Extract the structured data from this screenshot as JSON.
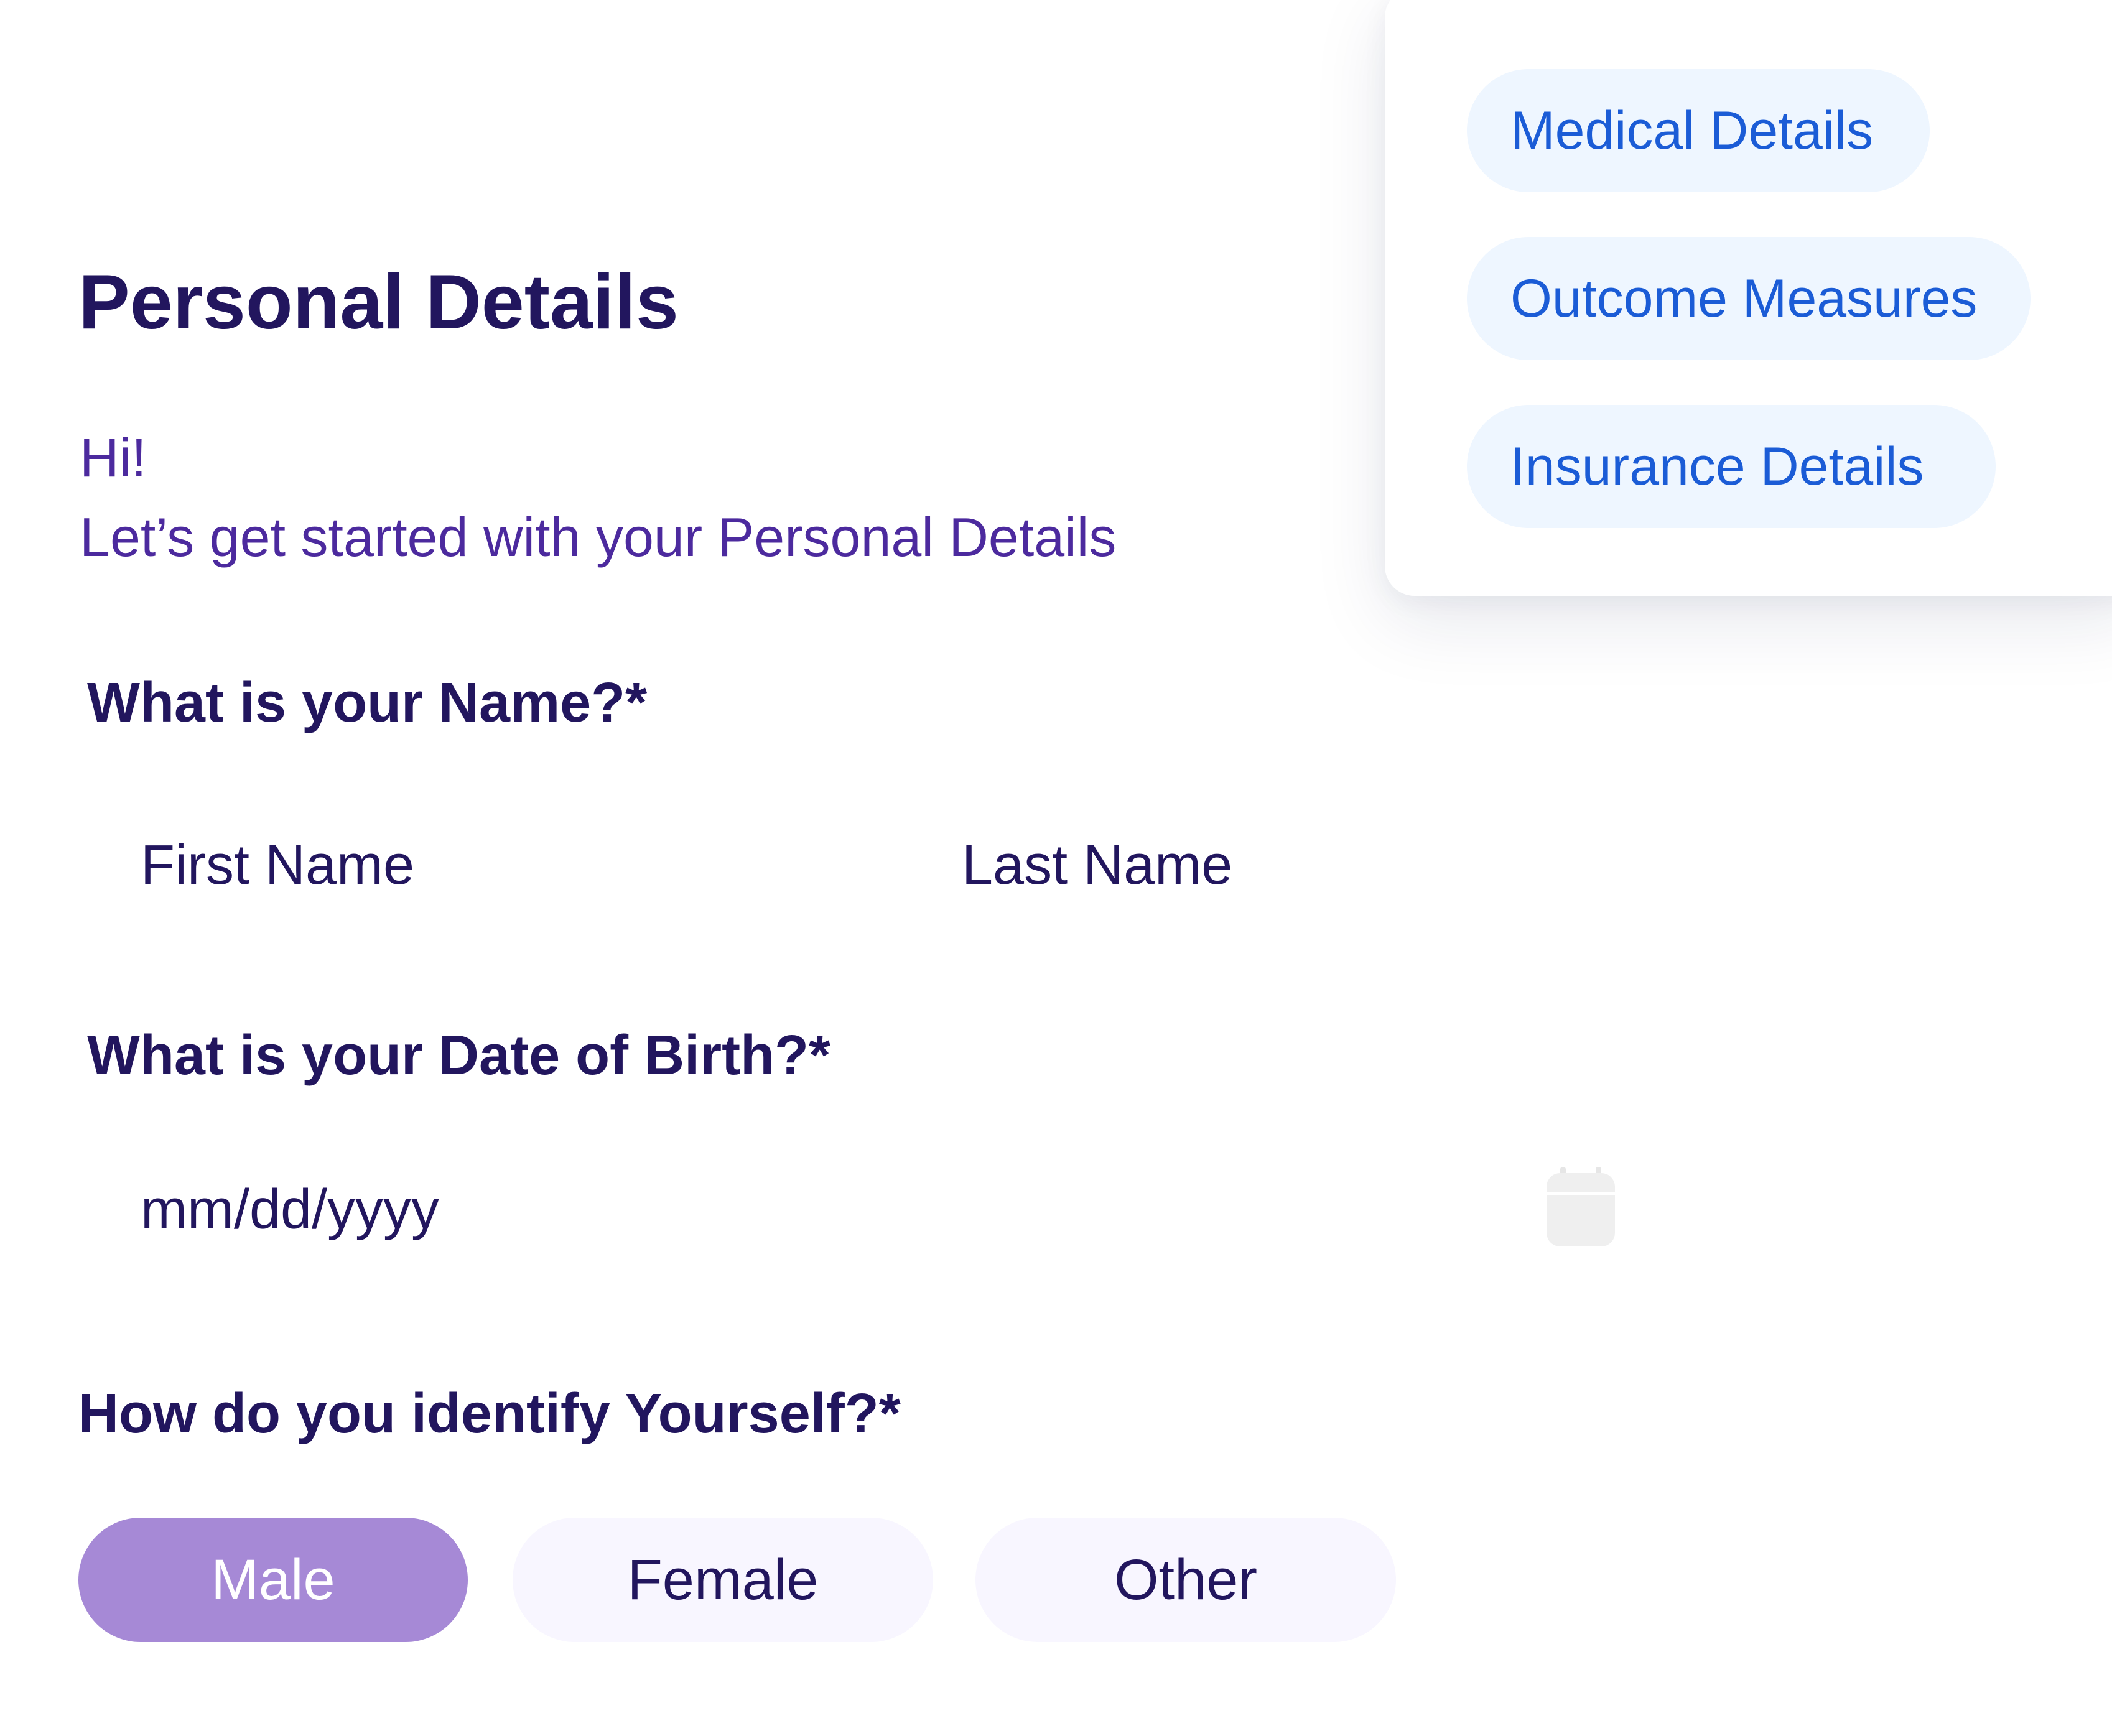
{
  "section_nav": {
    "items": [
      {
        "label": "Medical Details"
      },
      {
        "label": "Outcome Measures"
      },
      {
        "label": "Insurance Details"
      }
    ]
  },
  "form": {
    "title": "Personal Details",
    "greeting_line1": "Hi!",
    "greeting_line2": "Let’s get started with your Personal Details",
    "name_question": "What is your Name?*",
    "first_name_placeholder": "First Name",
    "last_name_placeholder": "Last Name",
    "dob_question": "What is your Date of Birth?*",
    "dob_placeholder": "mm/dd/yyyy",
    "identity_question": "How do you identify Yourself?*",
    "identity_options": [
      {
        "label": "Male",
        "selected": true
      },
      {
        "label": "Female",
        "selected": false
      },
      {
        "label": "Other",
        "selected": false
      }
    ]
  },
  "colors": {
    "heading": "#22165e",
    "greeting": "#4c2a9e",
    "chip_bg": "#eef6ff",
    "chip_text": "#1b5cd6",
    "selected_bg": "#a689d6",
    "unselected_bg": "#f8f6ff",
    "icon_gray": "#efefef"
  },
  "icons": {
    "date_picker": "calendar-icon"
  }
}
